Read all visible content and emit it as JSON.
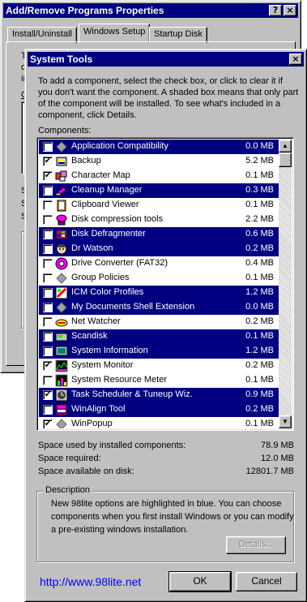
{
  "parent_window": {
    "title": "Add/Remove Programs Properties",
    "tabs": [
      "Install/Uninstall",
      "Windows Setup",
      "Startup Disk"
    ],
    "help_glyph": "?",
    "close_glyph": "×",
    "peek_letters": [
      "T",
      "d",
      "in",
      "C",
      "S",
      "S",
      "S"
    ]
  },
  "dialog": {
    "title": "System Tools",
    "close_glyph": "×",
    "instructions": "To add a component, select the check box, or click to clear it if you don't want the component. A shaded box means that only part of the component will be installed. To see what's included in a component, click Details.",
    "components_label": "Components:",
    "components": [
      {
        "name": "Application Compatibility",
        "size": "0.0 MB",
        "checked": false,
        "highlighted": true,
        "icon": "gray-diamond-icon"
      },
      {
        "name": "Backup",
        "size": "5.2 MB",
        "checked": true,
        "highlighted": false,
        "icon": "backup-icon"
      },
      {
        "name": "Character Map",
        "size": "0.1 MB",
        "checked": true,
        "highlighted": false,
        "icon": "character-map-icon"
      },
      {
        "name": "Cleanup Manager",
        "size": "0.3 MB",
        "checked": false,
        "highlighted": true,
        "icon": "cleanup-icon"
      },
      {
        "name": "Clipboard Viewer",
        "size": "0.1 MB",
        "checked": false,
        "highlighted": false,
        "icon": "clipboard-icon"
      },
      {
        "name": "Disk compression tools",
        "size": "2.2 MB",
        "checked": false,
        "highlighted": false,
        "icon": "disk-compression-icon"
      },
      {
        "name": "Disk Defragmenter",
        "size": "0.6 MB",
        "checked": false,
        "highlighted": true,
        "icon": "defrag-icon"
      },
      {
        "name": "Dr Watson",
        "size": "0.2 MB",
        "checked": false,
        "highlighted": true,
        "icon": "dr-watson-icon"
      },
      {
        "name": "Drive Converter (FAT32)",
        "size": "0.4 MB",
        "checked": false,
        "highlighted": false,
        "icon": "drive-converter-icon"
      },
      {
        "name": "Group Policies",
        "size": "0.1 MB",
        "checked": false,
        "highlighted": false,
        "icon": "gray-diamond-icon"
      },
      {
        "name": "ICM Color Profiles",
        "size": "1.2 MB",
        "checked": false,
        "highlighted": true,
        "icon": "color-profiles-icon"
      },
      {
        "name": "My Documents Shell Extension",
        "size": "0.0 MB",
        "checked": false,
        "highlighted": true,
        "icon": "gray-diamond-icon"
      },
      {
        "name": "Net Watcher",
        "size": "0.2 MB",
        "checked": false,
        "highlighted": false,
        "icon": "net-watcher-icon"
      },
      {
        "name": "Scandisk",
        "size": "0.1 MB",
        "checked": false,
        "highlighted": true,
        "icon": "scandisk-icon"
      },
      {
        "name": "System Information",
        "size": "1.2 MB",
        "checked": false,
        "highlighted": true,
        "icon": "system-info-icon"
      },
      {
        "name": "System Monitor",
        "size": "0.2 MB",
        "checked": true,
        "highlighted": false,
        "icon": "system-monitor-icon"
      },
      {
        "name": "System Resource Meter",
        "size": "0.1 MB",
        "checked": false,
        "highlighted": false,
        "icon": "resource-meter-icon"
      },
      {
        "name": "Task Scheduler & Tuneup Wiz.",
        "size": "0.9 MB",
        "checked": true,
        "highlighted": true,
        "icon": "task-scheduler-icon"
      },
      {
        "name": "WinAlign Tool",
        "size": "0.2 MB",
        "checked": false,
        "highlighted": true,
        "icon": "winalign-icon"
      },
      {
        "name": "WinPopup",
        "size": "0.1 MB",
        "checked": true,
        "highlighted": false,
        "icon": "gray-diamond-icon"
      }
    ],
    "space_used_label": "Space used by installed components:",
    "space_used_value": "78.9 MB",
    "space_required_label": "Space required:",
    "space_required_value": "12.0 MB",
    "space_available_label": "Space available on disk:",
    "space_available_value": "12801.7 MB",
    "description_label": "Description",
    "description_text": "New 98lite options are highlighted in blue. You can choose components when you first install Windows or you can modify a pre-existing windows installation.",
    "details_button": "Details...",
    "url": "http://www.98lite.net",
    "ok_button": "OK",
    "cancel_button": "Cancel",
    "check_glyph": "✔",
    "scroll_up_glyph": "▲",
    "scroll_down_glyph": "▼"
  },
  "colors": {
    "highlight": "#000080",
    "face": "#c0c0c0",
    "link": "#0000ff"
  }
}
